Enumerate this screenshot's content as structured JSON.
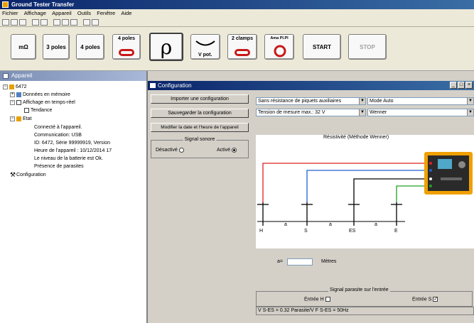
{
  "app": {
    "title": "Ground Tester Transfer"
  },
  "menu": [
    "Fichier",
    "Affichage",
    "Appareil",
    "Outils",
    "Fenêtre",
    "Aide"
  ],
  "modes": [
    {
      "label": "mΩ"
    },
    {
      "label": "3 poles"
    },
    {
      "label": "4 poles"
    },
    {
      "label": "4 poles"
    },
    {
      "label": "ρ"
    },
    {
      "label": "V pot."
    },
    {
      "label": "2 clamps"
    },
    {
      "label": "Ama Pl.Pl"
    },
    {
      "label": ""
    },
    {
      "label": "START"
    },
    {
      "label": "STOP"
    }
  ],
  "leftpane": {
    "title": "Appareil",
    "tree": {
      "root": "6472",
      "memory": "Données en mémoire",
      "realtime": "Affichage en temps-réel",
      "trend": "Tendance",
      "status": "Etat",
      "connected": "Connecté à l'appareil.",
      "comm": "Communication: USB",
      "id": "ID: 6472, Série 99999919, Version",
      "time": "Heure de l'appareil : 10/12/2014 17",
      "battery": "Le niveau de la batterie est Ok.",
      "interference": "Présence de parasites",
      "configuration": "Configuration"
    }
  },
  "config": {
    "title": "Configuration",
    "buttons": {
      "import": "Importer une configuration",
      "save": "Sauvegarder la configuration",
      "datetime": "Modifier la date et l'heure de l'appareil"
    },
    "signal": {
      "label": "Signal sonore",
      "off": "Désactivé",
      "on": "Activé"
    },
    "selects": {
      "resistance": "Sans résistance de piquets auxiliaires",
      "mode": "Mode Auto",
      "voltage": "Tension de mesure max.: 32 V",
      "method": "Wenner"
    },
    "diagram_title": "Résistivité (Méthode Wenner)",
    "electrodes": [
      "H",
      "S",
      "ES",
      "E"
    ],
    "spacing_label": "a",
    "a_label": "a=",
    "a_value": "",
    "a_unit": "Mètres",
    "interference": {
      "label": "Signal parasite sur l'entrée",
      "input_h": "Entrée H",
      "input_s": "Entrée S"
    },
    "status": "V S-ES = 0.32 Parasite/V   F S-ES = 50Hz"
  },
  "colors": {
    "red": "#e02020",
    "blue": "#2060d0",
    "black": "#000000",
    "green": "#20a020",
    "device_body": "#f0a000"
  }
}
